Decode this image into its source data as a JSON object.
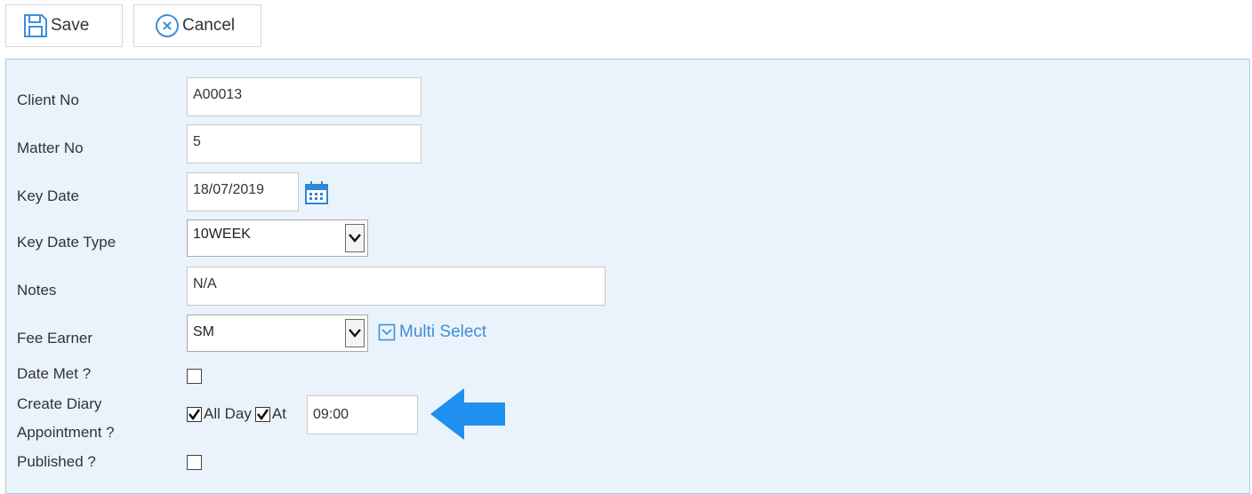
{
  "toolbar": {
    "save_label": "Save",
    "cancel_label": "Cancel"
  },
  "form": {
    "client_no": {
      "label": "Client No",
      "value": "A00013"
    },
    "matter_no": {
      "label": "Matter No",
      "value": "5"
    },
    "key_date": {
      "label": "Key Date",
      "value": "18/07/2019"
    },
    "key_date_type": {
      "label": "Key Date Type",
      "value": "10WEEK"
    },
    "notes": {
      "label": "Notes",
      "value": "N/A"
    },
    "fee_earner": {
      "label": "Fee Earner",
      "value": "SM",
      "multi_select_label": "Multi Select"
    },
    "date_met": {
      "label": "Date Met ?",
      "checked": false
    },
    "create_diary": {
      "label_line1": "Create Diary",
      "label_line2": "Appointment ?",
      "all_day_label": "All Day",
      "all_day_checked": true,
      "at_label": "At",
      "at_checked": true,
      "time_value": "09:00"
    },
    "published": {
      "label": "Published ?",
      "checked": false
    }
  },
  "icons": {
    "save": "floppy-disk-icon",
    "cancel": "circle-x-icon",
    "calendar": "calendar-icon",
    "dropdown": "chevron-down-icon",
    "multi_select": "checkbox-dropdown-icon",
    "pointer": "arrow-left-icon"
  },
  "colors": {
    "accent": "#3d8fd8",
    "panel_bg": "#eaf3fb",
    "panel_border": "#a9cde4",
    "arrow": "#1f8ff0"
  }
}
